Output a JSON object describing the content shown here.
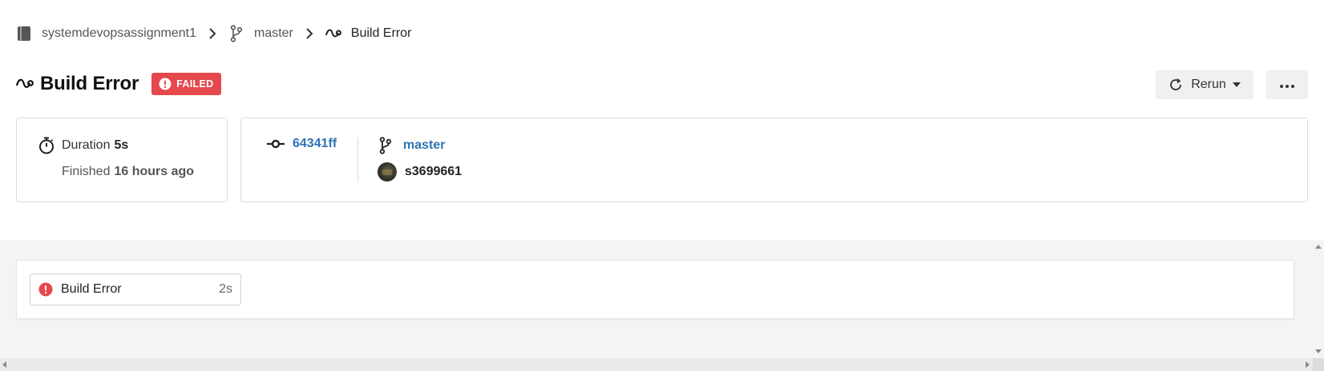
{
  "breadcrumb": {
    "repo": "systemdevopsassignment1",
    "branch": "master",
    "current": "Build Error"
  },
  "header": {
    "title": "Build Error",
    "status": "FAILED",
    "rerun_label": "Rerun"
  },
  "summary": {
    "duration_label": "Duration",
    "duration_value": "5s",
    "finished_label": "Finished",
    "finished_value": "16 hours ago"
  },
  "commit": {
    "sha": "64341ff",
    "branch": "master",
    "author": "s3699661"
  },
  "stages": [
    {
      "name": "Build Error",
      "duration": "2s"
    }
  ],
  "colors": {
    "failed": "#e5484d",
    "link": "#2d73b4",
    "stage_bg": "#f4f4f4"
  },
  "icons": {
    "repo": "book-icon",
    "branch": "git-branch-icon",
    "pipeline": "pipeline-icon",
    "status": "alert-circle-icon",
    "rerun": "refresh-icon",
    "more": "more-horizontal-icon",
    "duration": "stopwatch-icon",
    "commit": "git-commit-icon"
  }
}
